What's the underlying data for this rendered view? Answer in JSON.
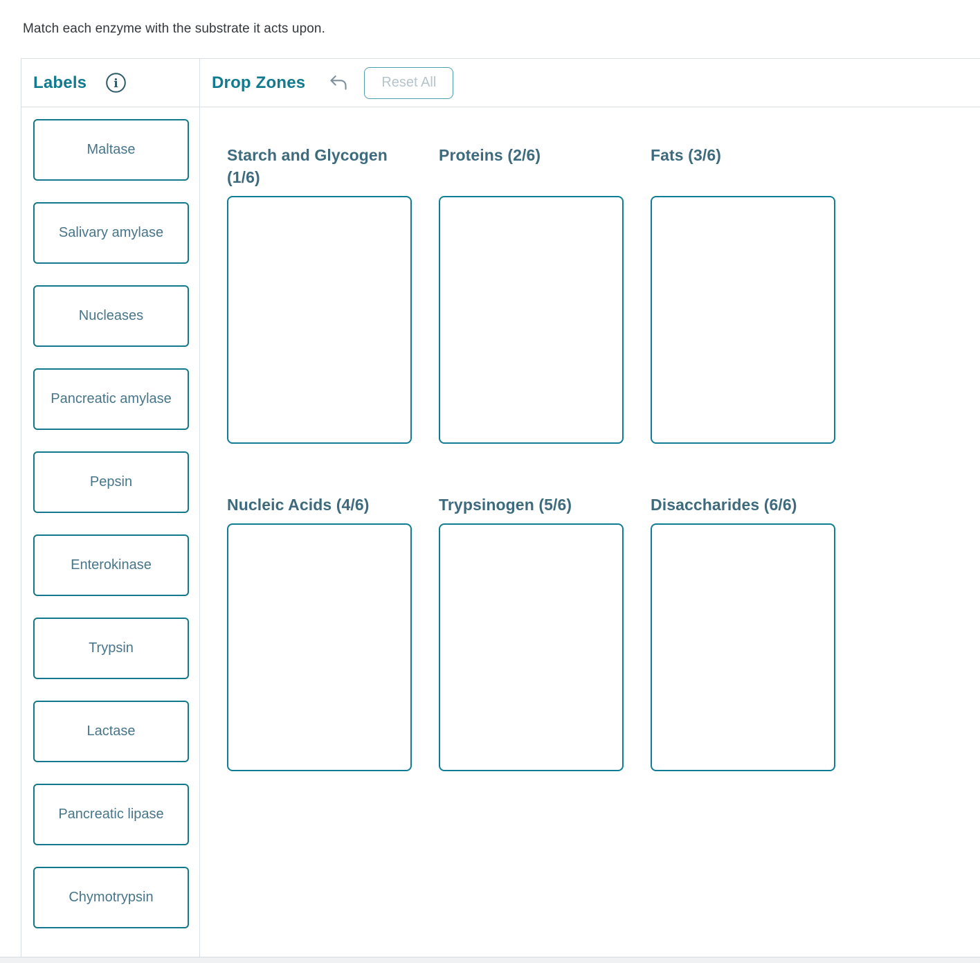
{
  "page": {
    "instruction": "Match each enzyme with the substrate it acts upon."
  },
  "labels_panel": {
    "title": "Labels",
    "info_icon": "info-icon",
    "items": [
      "Maltase",
      "Salivary amylase",
      "Nucleases",
      "Pancreatic amylase",
      "Pepsin",
      "Enterokinase",
      "Trypsin",
      "Lactase",
      "Pancreatic lipase",
      "Chymotrypsin"
    ]
  },
  "dropzones_panel": {
    "title": "Drop Zones",
    "undo_icon": "undo-arrow-icon",
    "reset_button_label": "Reset All",
    "zones": [
      {
        "title": "Starch and Glycogen (1/6)"
      },
      {
        "title": "Proteins (2/6)"
      },
      {
        "title": "Fats (3/6)"
      },
      {
        "title": "Nucleic Acids (4/6)"
      },
      {
        "title": "Trypsinogen (5/6)"
      },
      {
        "title": "Disaccharides (6/6)"
      }
    ]
  },
  "colors": {
    "accent_teal": "#117a8e",
    "chip_border": "#14788c",
    "chip_text": "#47758a",
    "zone_border": "#0f7d93",
    "zone_title": "#3d6b7d",
    "reset_border": "#4d9fae",
    "reset_text": "#b5c4cd",
    "divider": "#d9dfe2",
    "instruction_text": "#32373c"
  }
}
